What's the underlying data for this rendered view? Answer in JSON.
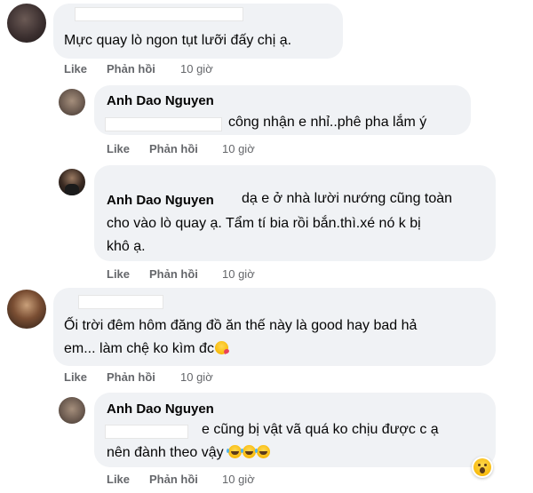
{
  "comments": [
    {
      "text_lines": [
        "Mực quay lò ngon tụt lưỡi đấy chị ạ."
      ],
      "actions": {
        "like": "Like",
        "reply": "Phản hồi",
        "time": "10 giờ"
      }
    },
    {
      "name": "Anh Dao Nguyen",
      "text_lines": [
        "công nhận e nhỉ..phê pha lắm ý"
      ],
      "actions": {
        "like": "Like",
        "reply": "Phản hồi",
        "time": "10 giờ"
      }
    },
    {
      "name": "Anh Dao Nguyen",
      "text_lines": [
        "dạ e ở nhà lười nướng cũng toàn",
        "cho vào lò quay ạ. Tẩm tí bia rồi bắn.thì.xé nó k bị",
        "khô ạ."
      ],
      "actions": {
        "like": "Like",
        "reply": "Phản hồi",
        "time": "10 giờ"
      }
    },
    {
      "text_lines": [
        "Ối trời đêm hôm đăng đồ ăn thế này là good hay bad hả",
        "em... làm chệ ko kìm đc"
      ],
      "actions": {
        "like": "Like",
        "reply": "Phản hồi",
        "time": "10 giờ"
      }
    },
    {
      "name": "Anh Dao Nguyen",
      "text_lines": [
        "e cũng bị vật vã quá ko chịu được c ạ",
        "nên đành theo vậy"
      ],
      "actions": {
        "like": "Like",
        "reply": "Phản hồi",
        "time": "10 giờ"
      }
    }
  ],
  "icons": {
    "kiss_emoji": "face-blowing-kiss",
    "laugh_emoji": "rolling-on-floor-laughing",
    "reaction": "wow-reaction"
  },
  "colors": {
    "bubble": "#f0f2f5",
    "meta_text": "#65676b",
    "text": "#050505"
  }
}
